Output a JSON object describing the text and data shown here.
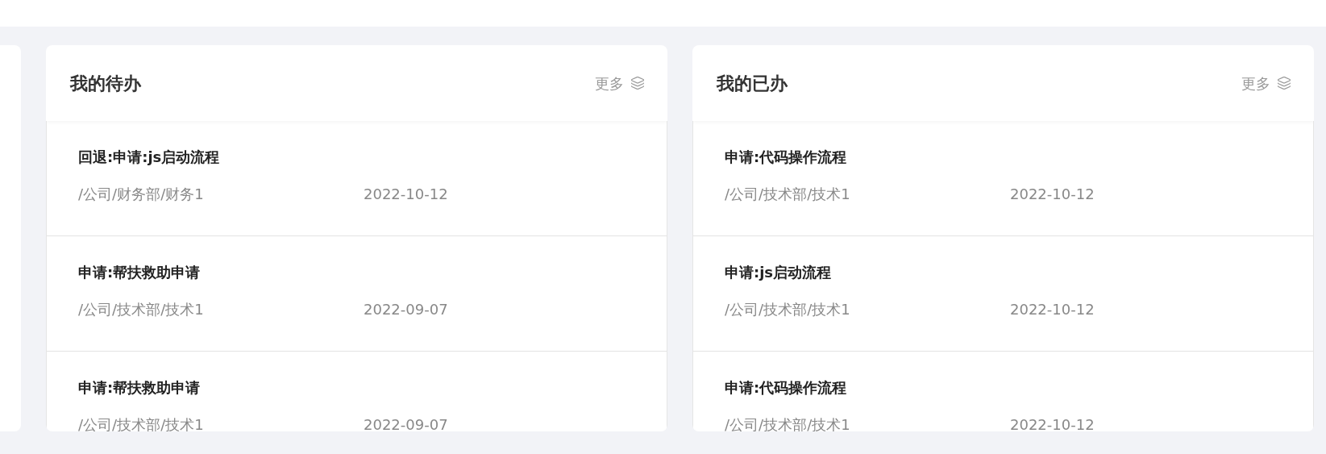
{
  "panels": [
    {
      "title": "我的待办",
      "more": "更多",
      "items": [
        {
          "title": "回退:申请:js启动流程",
          "dept": "/公司/财务部/财务1",
          "date": "2022-10-12"
        },
        {
          "title": "申请:帮扶救助申请",
          "dept": "/公司/技术部/技术1",
          "date": "2022-09-07"
        },
        {
          "title": "申请:帮扶救助申请",
          "dept": "/公司/技术部/技术1",
          "date": "2022-09-07"
        }
      ]
    },
    {
      "title": "我的已办",
      "more": "更多",
      "items": [
        {
          "title": "申请:代码操作流程",
          "dept": "/公司/技术部/技术1",
          "date": "2022-10-12"
        },
        {
          "title": "申请:js启动流程",
          "dept": "/公司/技术部/技术1",
          "date": "2022-10-12"
        },
        {
          "title": "申请:代码操作流程",
          "dept": "/公司/技术部/技术1",
          "date": "2022-10-12"
        }
      ]
    }
  ]
}
